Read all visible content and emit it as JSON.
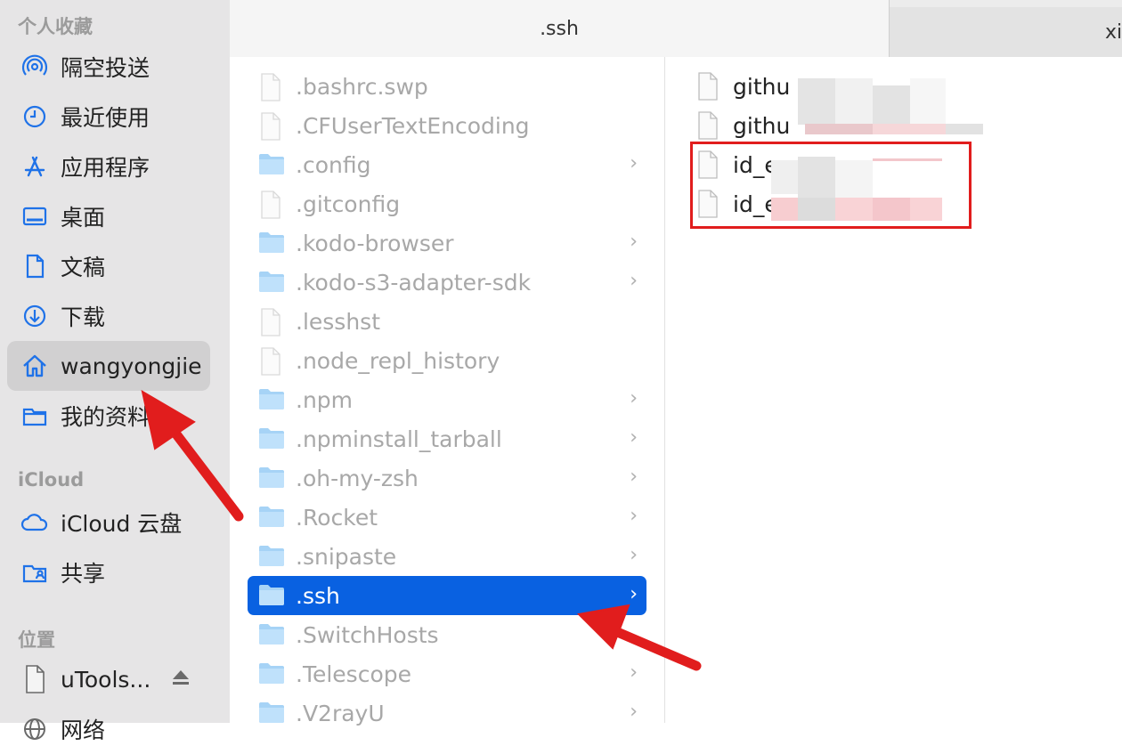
{
  "sidebar": {
    "favorites_title": "个人收藏",
    "favorites": [
      {
        "label": "隔空投送",
        "icon": "airdrop-icon"
      },
      {
        "label": "最近使用",
        "icon": "clock-icon"
      },
      {
        "label": "应用程序",
        "icon": "applications-icon"
      },
      {
        "label": "桌面",
        "icon": "desktop-icon"
      },
      {
        "label": "文稿",
        "icon": "document-icon"
      },
      {
        "label": "下载",
        "icon": "download-icon"
      },
      {
        "label": "wangyongjie",
        "icon": "home-icon",
        "selected": true
      },
      {
        "label": "我的资料库",
        "icon": "folder-icon"
      }
    ],
    "icloud_title": "iCloud",
    "icloud": [
      {
        "label": "iCloud 云盘",
        "icon": "cloud-icon"
      },
      {
        "label": "共享",
        "icon": "shared-folder-icon"
      }
    ],
    "locations_title": "位置",
    "locations": [
      {
        "label": "uTools...",
        "icon": "disk-icon"
      },
      {
        "label": "网络",
        "icon": "network-icon"
      }
    ]
  },
  "tabs": [
    {
      "label": ".ssh",
      "active": true
    },
    {
      "label": "xia",
      "active": false
    }
  ],
  "column1": [
    {
      "name": ".bashrc.swp",
      "type": "file",
      "chevron": false
    },
    {
      "name": ".CFUserTextEncoding",
      "type": "file",
      "chevron": false
    },
    {
      "name": ".config",
      "type": "folder",
      "chevron": true
    },
    {
      "name": ".gitconfig",
      "type": "file",
      "chevron": false
    },
    {
      "name": ".kodo-browser",
      "type": "folder",
      "chevron": true
    },
    {
      "name": ".kodo-s3-adapter-sdk",
      "type": "folder",
      "chevron": true
    },
    {
      "name": ".lesshst",
      "type": "file",
      "chevron": false
    },
    {
      "name": ".node_repl_history",
      "type": "file",
      "chevron": false
    },
    {
      "name": ".npm",
      "type": "folder",
      "chevron": true
    },
    {
      "name": ".npminstall_tarball",
      "type": "folder",
      "chevron": true
    },
    {
      "name": ".oh-my-zsh",
      "type": "folder",
      "chevron": true
    },
    {
      "name": ".Rocket",
      "type": "folder",
      "chevron": true
    },
    {
      "name": ".snipaste",
      "type": "folder",
      "chevron": true
    },
    {
      "name": ".ssh",
      "type": "folder",
      "chevron": true,
      "selected": true
    },
    {
      "name": ".SwitchHosts",
      "type": "folder",
      "chevron": false
    },
    {
      "name": ".Telescope",
      "type": "folder",
      "chevron": true
    },
    {
      "name": ".V2rayU",
      "type": "folder",
      "chevron": true
    }
  ],
  "column2": [
    {
      "name": "githu"
    },
    {
      "name": "githu"
    },
    {
      "name": "id_e"
    },
    {
      "name": "id_e"
    }
  ],
  "chevron_glyph": "›",
  "accent_color": "#0961e1",
  "annotation_color": "#e11d1d"
}
